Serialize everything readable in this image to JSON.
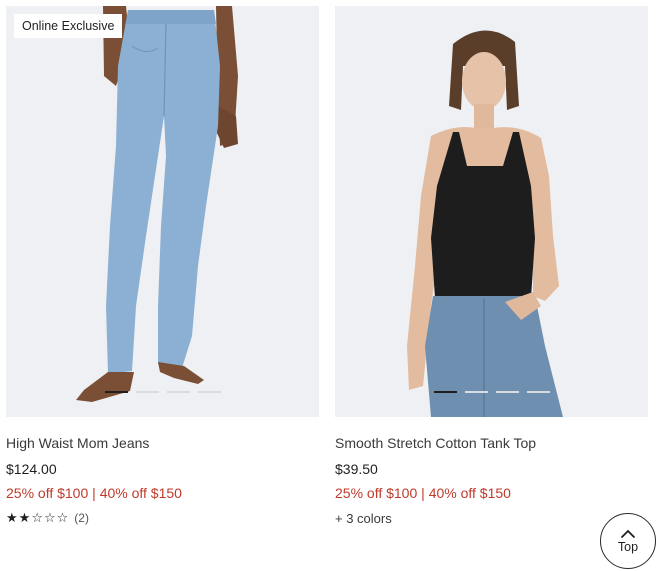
{
  "products": [
    {
      "badge": "Online Exclusive",
      "name": "High Waist Mom Jeans",
      "price": "$124.00",
      "promo_a": "25% off $100",
      "promo_sep": "|",
      "promo_b": "40% off $150",
      "rating_filled": 2,
      "rating_max": 5,
      "review_count": "(2)",
      "image_dots": 4,
      "active_dot": 0
    },
    {
      "name": "Smooth Stretch Cotton Tank Top",
      "price": "$39.50",
      "promo_a": "25% off $100",
      "promo_sep": "|",
      "promo_b": "40% off $150",
      "colors": "+ 3 colors",
      "image_dots": 4,
      "active_dot": 0
    }
  ],
  "back_to_top": {
    "label": "Top",
    "icon": "chevron-up-icon"
  },
  "colors": {
    "promo": "#c0392b",
    "text": "#1f1f1f",
    "image_bg": "#eef0f3"
  }
}
